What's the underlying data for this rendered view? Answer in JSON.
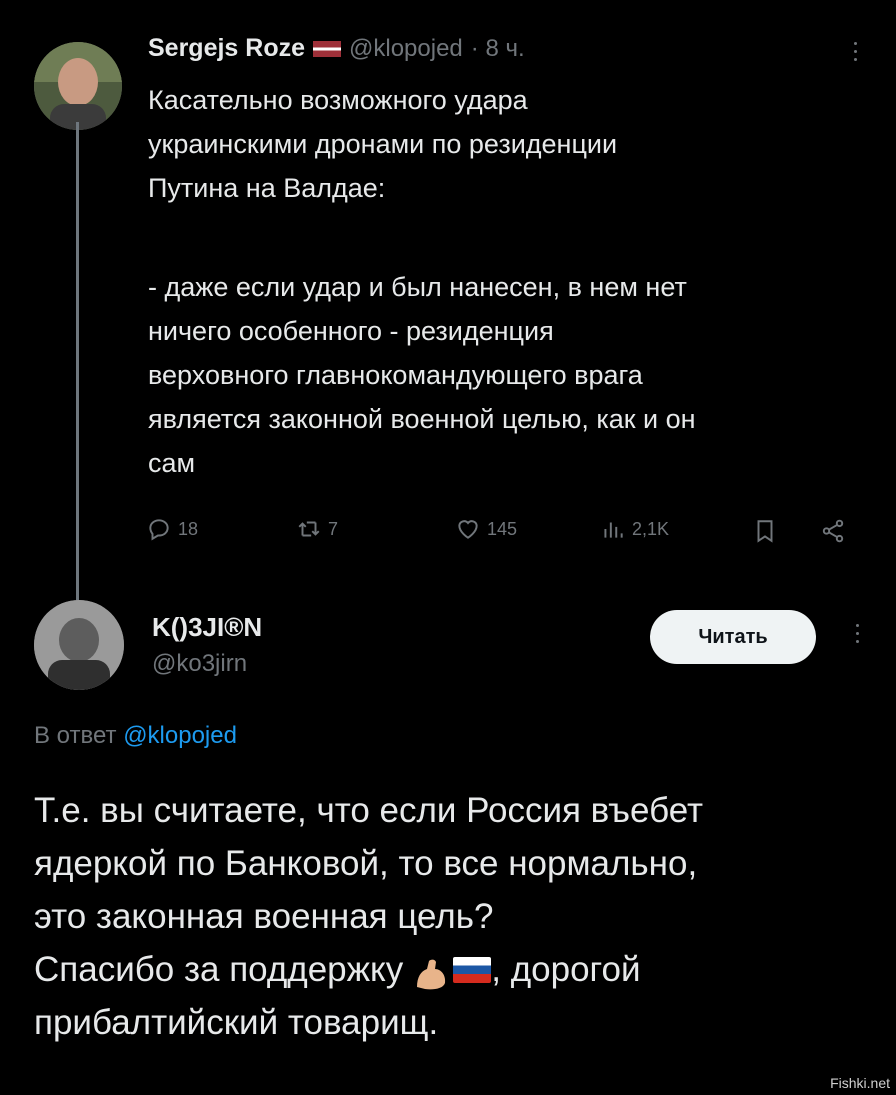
{
  "tweet": {
    "author_name": "Sergejs Roze",
    "handle": "@klopojed",
    "time": "· 8 ч.",
    "text_p1": "Касательно возможного удара\nукраинскими дронами по резиденции\nПутина на Валдае:",
    "text_p2": "- даже если удар и был нанесен, в нем нет\nничего особенного - резиденция\nверховного главнокомандующего врага\nявляется законной военной целью, как и он\nсам",
    "replies": "18",
    "retweets": "7",
    "likes": "145",
    "views": "2,1K"
  },
  "reply": {
    "author_name": "K()3JI®N",
    "handle": "@ko3jirn",
    "follow_label": "Читать",
    "in_reply_prefix": "В ответ",
    "in_reply_handle": "@klopojed",
    "text_l1": "Т.е. вы считаете, что если Россия въебет",
    "text_l2": "ядеркой по Банковой, то все нормально,",
    "text_l3": "это законная военная цель?",
    "text_l4a": "Спасибо за поддержку",
    "text_l4b": ", дорогой",
    "text_l5": "прибалтийский товарищ."
  },
  "watermark": "Fishki.net",
  "colors": {
    "background": "#000000",
    "text": "#e7e9ea",
    "muted": "#71767b",
    "link": "#1d9bf0",
    "latvia_red": "#9e3039",
    "follow_bg": "#eff3f4"
  },
  "icons": [
    "more-icon",
    "reply-icon",
    "retweet-icon",
    "like-icon",
    "views-icon",
    "bookmark-icon",
    "share-icon",
    "flexed-biceps-emoji",
    "russia-flag-emoji",
    "latvia-flag-emoji"
  ]
}
